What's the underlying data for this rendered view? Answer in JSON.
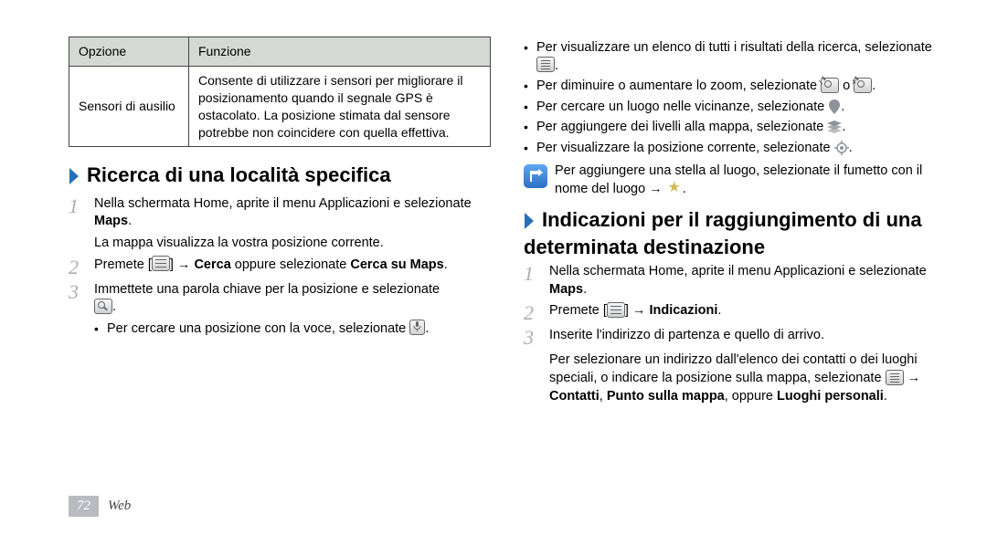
{
  "table": {
    "header_opt": "Opzione",
    "header_fun": "Funzione",
    "row_opt": "Sensori di ausilio",
    "row_fun": "Consente di utilizzare i sensori per migliorare il posizionamento quando il segnale GPS è ostacolato. La posizione stimata dal sensore potrebbe non coincidere con quella effettiva."
  },
  "h_search": "Ricerca di una località specifica",
  "s1": {
    "pre": "Nella schermata Home, aprite il menu Applicazioni e selezionate ",
    "bold": "Maps",
    "post": ".",
    "sub": "La mappa visualizza la vostra posizione corrente."
  },
  "s2": {
    "pre": "Premete [",
    "mid1": "] → ",
    "b1": "Cerca",
    "mid2": " oppure selezionate ",
    "b2": "Cerca su Maps",
    "post": "."
  },
  "s3": {
    "text": "Immettete una parola chiave per la posizione e selezionate ",
    "post": ".",
    "bullet": "Per cercare una posizione con la voce, selezionate ",
    "bullet_post": "."
  },
  "rb": {
    "b1a": "Per visualizzare un elenco di tutti i risultati della ricerca, selezionate ",
    "b1b": ".",
    "b2a": "Per diminuire o aumentare lo zoom, selezionate ",
    "b2mid": " o ",
    "b2b": ".",
    "b3a": "Per cercare un luogo nelle vicinanze, selezionate ",
    "b3b": ".",
    "b4a": "Per aggiungere dei livelli alla mappa, selezionate ",
    "b4b": ".",
    "b5a": "Per visualizzare la posizione corrente, selezionate ",
    "b5b": "."
  },
  "note": {
    "a": "Per aggiungere una stella al luogo, selezionate il fumetto con il nome del luogo → ",
    "b": "."
  },
  "h_dir": "Indicazioni per il raggiungimento di una determinata destinazione",
  "d1": {
    "pre": "Nella schermata Home, aprite il menu Applicazioni e selezionate ",
    "bold": "Maps",
    "post": "."
  },
  "d2": {
    "pre": "Premete [",
    "mid": "] → ",
    "bold": "Indicazioni",
    "post": "."
  },
  "d3": {
    "text": "Inserite l'indirizzo di partenza e quello di arrivo.",
    "sub_a": "Per selezionare un indirizzo dall'elenco dei contatti o dei luoghi speciali, o indicare la posizione sulla mappa, selezionate ",
    "sub_mid": " → ",
    "b1": "Contatti",
    "sep1": ", ",
    "b2": "Punto sulla mappa",
    "sep2": ", oppure ",
    "b3": "Luoghi personali",
    "sub_b": "."
  },
  "footer": {
    "page": "72",
    "section": "Web"
  }
}
